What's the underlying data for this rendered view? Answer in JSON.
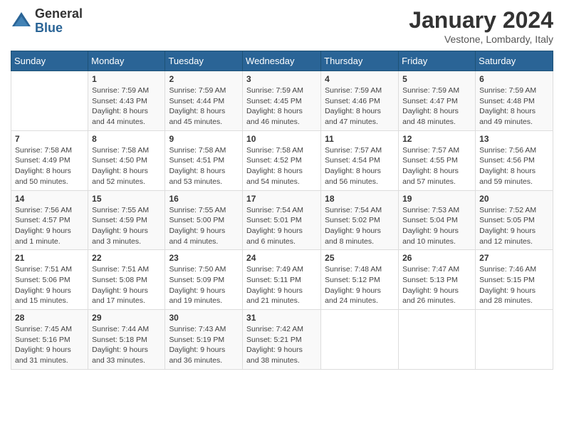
{
  "logo": {
    "general": "General",
    "blue": "Blue"
  },
  "title": "January 2024",
  "location": "Vestone, Lombardy, Italy",
  "weekdays": [
    "Sunday",
    "Monday",
    "Tuesday",
    "Wednesday",
    "Thursday",
    "Friday",
    "Saturday"
  ],
  "weeks": [
    [
      {
        "day": "",
        "sunrise": "",
        "sunset": "",
        "daylight": ""
      },
      {
        "day": "1",
        "sunrise": "Sunrise: 7:59 AM",
        "sunset": "Sunset: 4:43 PM",
        "daylight": "Daylight: 8 hours and 44 minutes."
      },
      {
        "day": "2",
        "sunrise": "Sunrise: 7:59 AM",
        "sunset": "Sunset: 4:44 PM",
        "daylight": "Daylight: 8 hours and 45 minutes."
      },
      {
        "day": "3",
        "sunrise": "Sunrise: 7:59 AM",
        "sunset": "Sunset: 4:45 PM",
        "daylight": "Daylight: 8 hours and 46 minutes."
      },
      {
        "day": "4",
        "sunrise": "Sunrise: 7:59 AM",
        "sunset": "Sunset: 4:46 PM",
        "daylight": "Daylight: 8 hours and 47 minutes."
      },
      {
        "day": "5",
        "sunrise": "Sunrise: 7:59 AM",
        "sunset": "Sunset: 4:47 PM",
        "daylight": "Daylight: 8 hours and 48 minutes."
      },
      {
        "day": "6",
        "sunrise": "Sunrise: 7:59 AM",
        "sunset": "Sunset: 4:48 PM",
        "daylight": "Daylight: 8 hours and 49 minutes."
      }
    ],
    [
      {
        "day": "7",
        "sunrise": "Sunrise: 7:58 AM",
        "sunset": "Sunset: 4:49 PM",
        "daylight": "Daylight: 8 hours and 50 minutes."
      },
      {
        "day": "8",
        "sunrise": "Sunrise: 7:58 AM",
        "sunset": "Sunset: 4:50 PM",
        "daylight": "Daylight: 8 hours and 52 minutes."
      },
      {
        "day": "9",
        "sunrise": "Sunrise: 7:58 AM",
        "sunset": "Sunset: 4:51 PM",
        "daylight": "Daylight: 8 hours and 53 minutes."
      },
      {
        "day": "10",
        "sunrise": "Sunrise: 7:58 AM",
        "sunset": "Sunset: 4:52 PM",
        "daylight": "Daylight: 8 hours and 54 minutes."
      },
      {
        "day": "11",
        "sunrise": "Sunrise: 7:57 AM",
        "sunset": "Sunset: 4:54 PM",
        "daylight": "Daylight: 8 hours and 56 minutes."
      },
      {
        "day": "12",
        "sunrise": "Sunrise: 7:57 AM",
        "sunset": "Sunset: 4:55 PM",
        "daylight": "Daylight: 8 hours and 57 minutes."
      },
      {
        "day": "13",
        "sunrise": "Sunrise: 7:56 AM",
        "sunset": "Sunset: 4:56 PM",
        "daylight": "Daylight: 8 hours and 59 minutes."
      }
    ],
    [
      {
        "day": "14",
        "sunrise": "Sunrise: 7:56 AM",
        "sunset": "Sunset: 4:57 PM",
        "daylight": "Daylight: 9 hours and 1 minute."
      },
      {
        "day": "15",
        "sunrise": "Sunrise: 7:55 AM",
        "sunset": "Sunset: 4:59 PM",
        "daylight": "Daylight: 9 hours and 3 minutes."
      },
      {
        "day": "16",
        "sunrise": "Sunrise: 7:55 AM",
        "sunset": "Sunset: 5:00 PM",
        "daylight": "Daylight: 9 hours and 4 minutes."
      },
      {
        "day": "17",
        "sunrise": "Sunrise: 7:54 AM",
        "sunset": "Sunset: 5:01 PM",
        "daylight": "Daylight: 9 hours and 6 minutes."
      },
      {
        "day": "18",
        "sunrise": "Sunrise: 7:54 AM",
        "sunset": "Sunset: 5:02 PM",
        "daylight": "Daylight: 9 hours and 8 minutes."
      },
      {
        "day": "19",
        "sunrise": "Sunrise: 7:53 AM",
        "sunset": "Sunset: 5:04 PM",
        "daylight": "Daylight: 9 hours and 10 minutes."
      },
      {
        "day": "20",
        "sunrise": "Sunrise: 7:52 AM",
        "sunset": "Sunset: 5:05 PM",
        "daylight": "Daylight: 9 hours and 12 minutes."
      }
    ],
    [
      {
        "day": "21",
        "sunrise": "Sunrise: 7:51 AM",
        "sunset": "Sunset: 5:06 PM",
        "daylight": "Daylight: 9 hours and 15 minutes."
      },
      {
        "day": "22",
        "sunrise": "Sunrise: 7:51 AM",
        "sunset": "Sunset: 5:08 PM",
        "daylight": "Daylight: 9 hours and 17 minutes."
      },
      {
        "day": "23",
        "sunrise": "Sunrise: 7:50 AM",
        "sunset": "Sunset: 5:09 PM",
        "daylight": "Daylight: 9 hours and 19 minutes."
      },
      {
        "day": "24",
        "sunrise": "Sunrise: 7:49 AM",
        "sunset": "Sunset: 5:11 PM",
        "daylight": "Daylight: 9 hours and 21 minutes."
      },
      {
        "day": "25",
        "sunrise": "Sunrise: 7:48 AM",
        "sunset": "Sunset: 5:12 PM",
        "daylight": "Daylight: 9 hours and 24 minutes."
      },
      {
        "day": "26",
        "sunrise": "Sunrise: 7:47 AM",
        "sunset": "Sunset: 5:13 PM",
        "daylight": "Daylight: 9 hours and 26 minutes."
      },
      {
        "day": "27",
        "sunrise": "Sunrise: 7:46 AM",
        "sunset": "Sunset: 5:15 PM",
        "daylight": "Daylight: 9 hours and 28 minutes."
      }
    ],
    [
      {
        "day": "28",
        "sunrise": "Sunrise: 7:45 AM",
        "sunset": "Sunset: 5:16 PM",
        "daylight": "Daylight: 9 hours and 31 minutes."
      },
      {
        "day": "29",
        "sunrise": "Sunrise: 7:44 AM",
        "sunset": "Sunset: 5:18 PM",
        "daylight": "Daylight: 9 hours and 33 minutes."
      },
      {
        "day": "30",
        "sunrise": "Sunrise: 7:43 AM",
        "sunset": "Sunset: 5:19 PM",
        "daylight": "Daylight: 9 hours and 36 minutes."
      },
      {
        "day": "31",
        "sunrise": "Sunrise: 7:42 AM",
        "sunset": "Sunset: 5:21 PM",
        "daylight": "Daylight: 9 hours and 38 minutes."
      },
      {
        "day": "",
        "sunrise": "",
        "sunset": "",
        "daylight": ""
      },
      {
        "day": "",
        "sunrise": "",
        "sunset": "",
        "daylight": ""
      },
      {
        "day": "",
        "sunrise": "",
        "sunset": "",
        "daylight": ""
      }
    ]
  ]
}
